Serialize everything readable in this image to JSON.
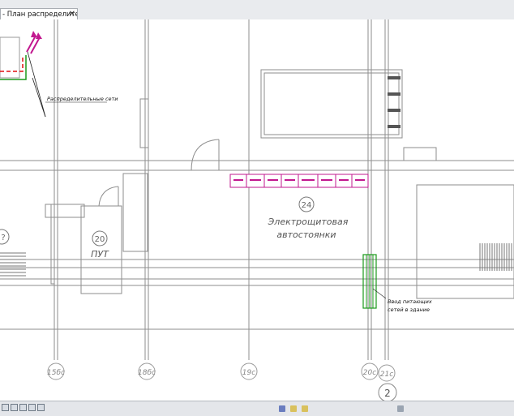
{
  "window": {
    "tab_title": "- План распределительн...",
    "tab_close_glyph": "✕"
  },
  "drawing": {
    "annotations": {
      "distribution_networks": "Распределительные сети",
      "entry_line1": "Ввод питающих",
      "entry_line2": "сетей в здание"
    },
    "rooms": [
      {
        "number": "24",
        "name_line1": "Электрощитовая",
        "name_line2": "автостоянки"
      },
      {
        "number": "20",
        "name_line1": "ПУТ"
      },
      {
        "number": "?",
        "name_line1": ""
      }
    ],
    "grid_axes": [
      "15бс",
      "18бс",
      "19с",
      "20с",
      "21с"
    ],
    "section_marker": "2",
    "colors": {
      "panel_magenta": "#c2188f",
      "entry_green": "#1a9a1a",
      "red_dash": "#e01010",
      "line_gray": "#9a9a9a"
    }
  },
  "statusbar": {
    "left_icons": [
      "view-scale-icon",
      "detail-level-icon",
      "visual-style-icon",
      "sun-path-icon",
      "shadows-icon"
    ],
    "right_icons": [
      "worksets-icon",
      "design-options-icon",
      "selection-filter-icon",
      "filter-icon"
    ]
  }
}
